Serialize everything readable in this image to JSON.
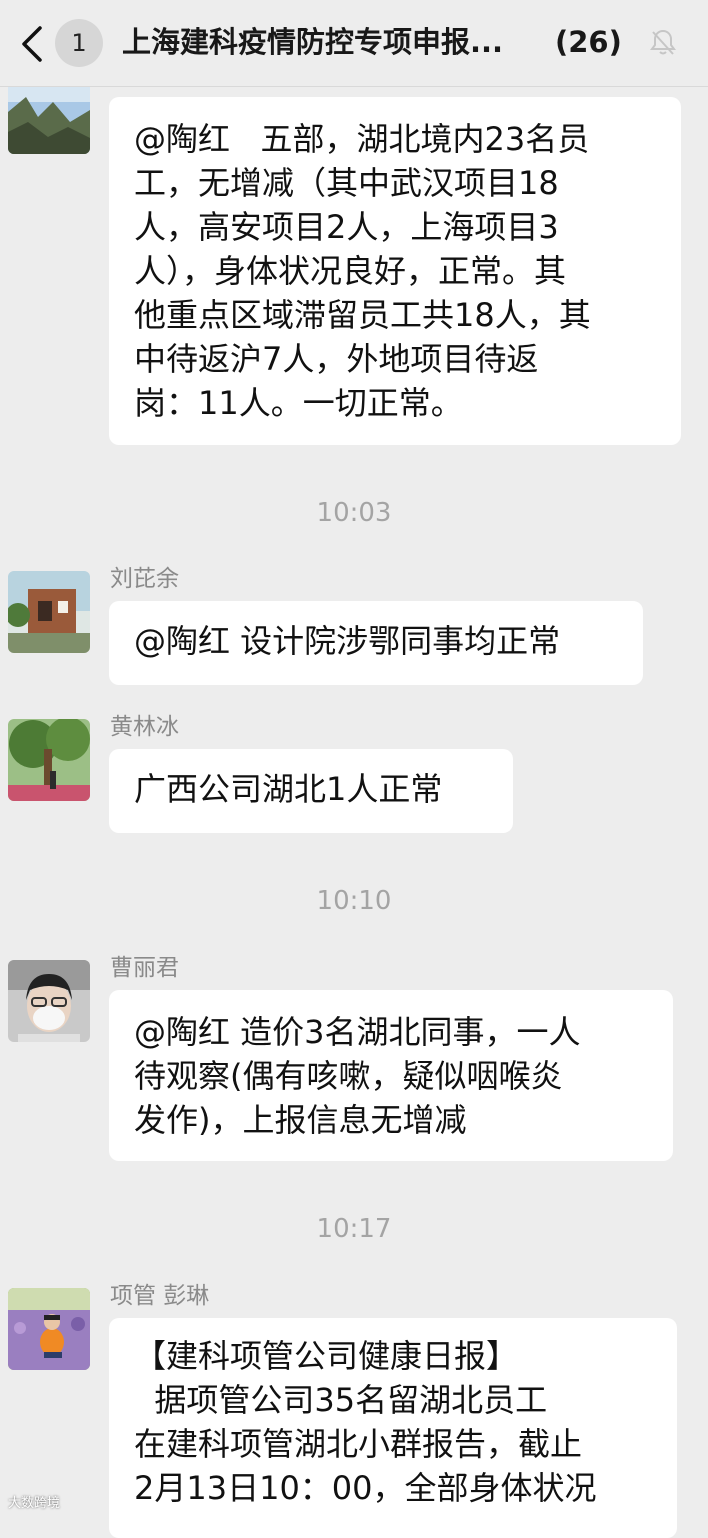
{
  "header": {
    "back_badge": "1",
    "title": "上海建科疫情防控专项申报...",
    "member_count": "(26)",
    "back_icon": "chevron-left-icon",
    "mute_icon": "bell-muted-icon"
  },
  "messages": [
    {
      "text": "@陶红   五部，湖北境内23名员\n工，无增减（其中武汉项目18\n人，高安项目2人，上海项目3\n人），身体状况良好，正常。其\n他重点区域滞留员工共18人，其\n中待返沪7人，外地项目待返\n岗：11人。一切正常。"
    },
    {
      "time": "10:03",
      "sender": "刘芘余",
      "text": "@陶红 设计院涉鄂同事均正常"
    },
    {
      "sender": "黄林冰",
      "text": "广西公司湖北1人正常"
    },
    {
      "time": "10:10",
      "sender": "曹丽君",
      "text": "@陶红 造价3名湖北同事，一人\n待观察(偶有咳嗽，疑似咽喉炎\n发作)，上报信息无增减"
    },
    {
      "time": "10:17",
      "sender": "项管 彭琳",
      "text": "【建科项管公司健康日报】\n  据项管公司35名留湖北员工\n在建科项管湖北小群报告，截止\n2月13日10：00，全部身体状况"
    }
  ],
  "watermark": "大数跨境",
  "colors": {
    "background": "#ededed",
    "bubble": "#ffffff",
    "meta_text": "#a4a4a4"
  }
}
